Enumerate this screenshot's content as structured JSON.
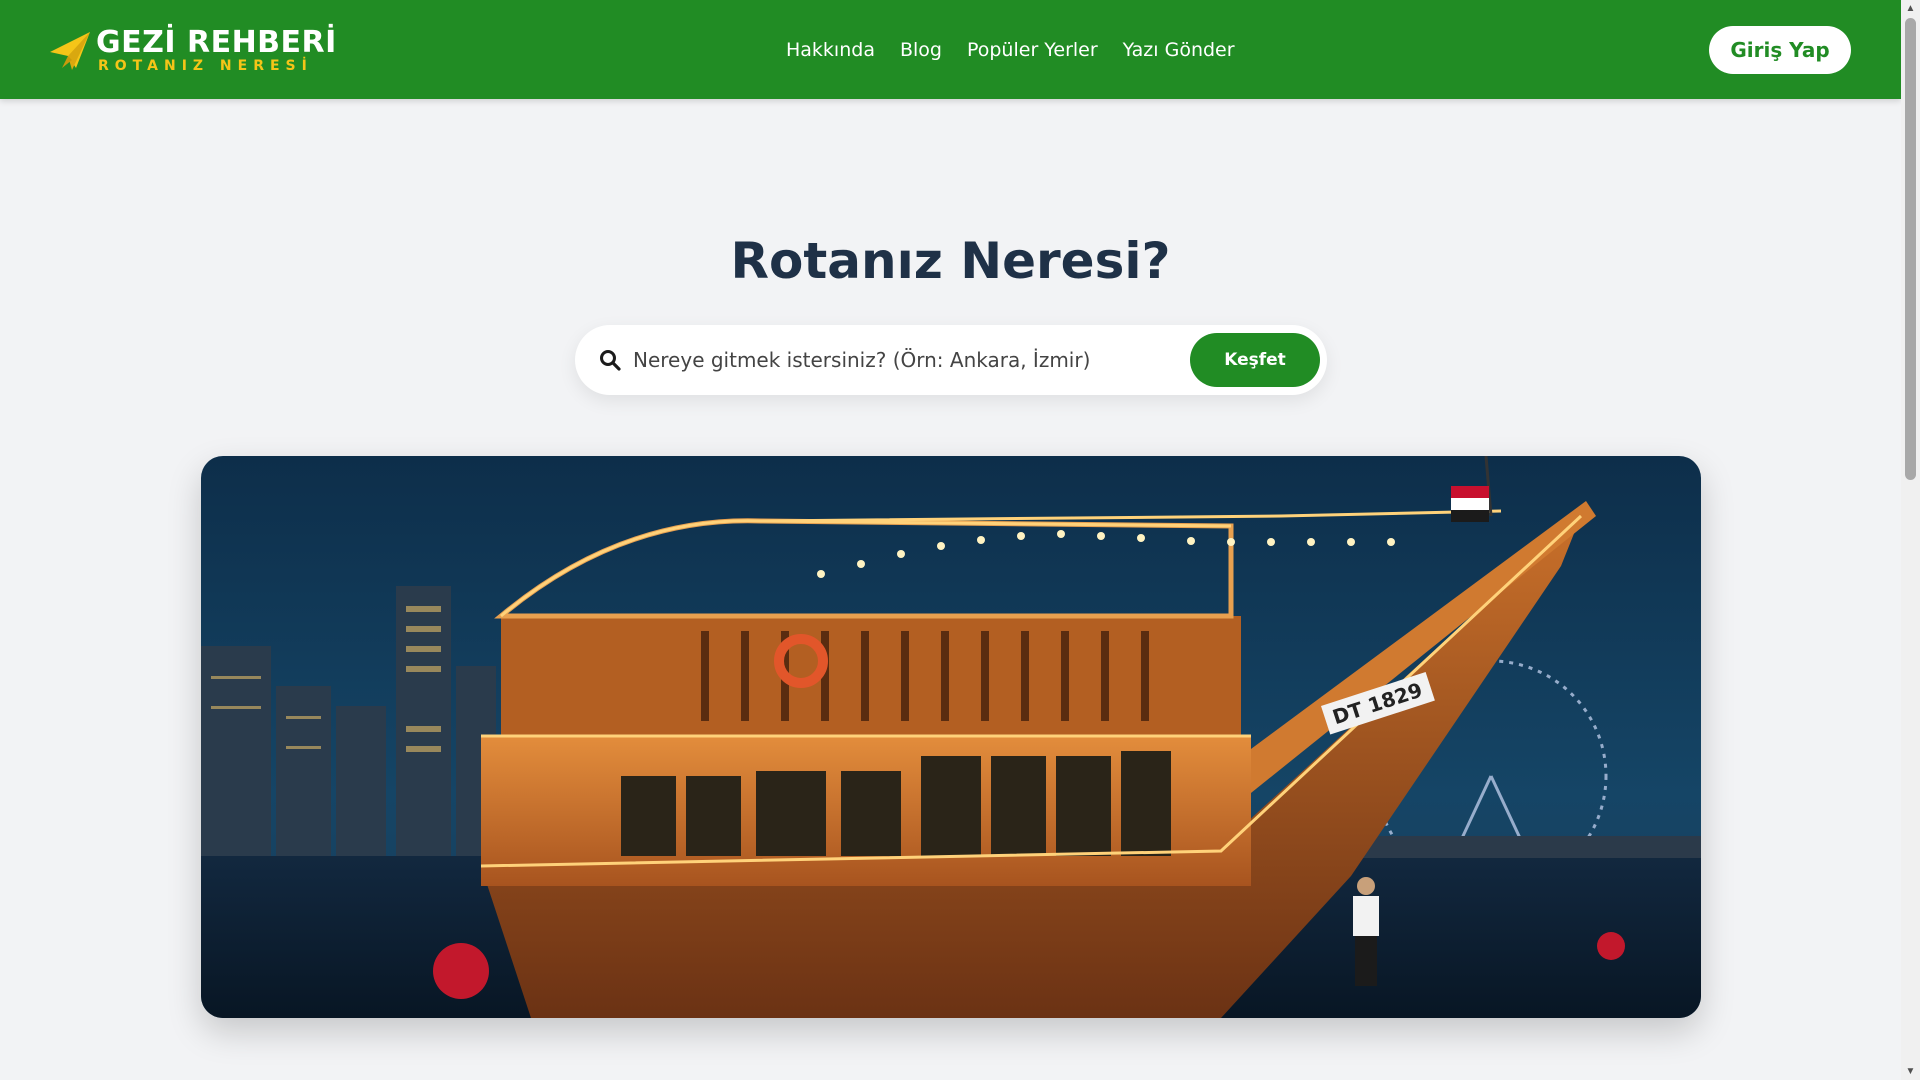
{
  "brand": {
    "title": "GEZİ REHBERİ",
    "subtitle": "ROTANIZ NERESİ",
    "colors": {
      "primary": "#218c24",
      "accent": "#f5c518",
      "heading": "#1f3147",
      "background": "#f2f3f5"
    }
  },
  "nav": {
    "items": [
      {
        "label": "Hakkında"
      },
      {
        "label": "Blog"
      },
      {
        "label": "Popüler Yerler"
      },
      {
        "label": "Yazı Gönder"
      }
    ],
    "login_label": "Giriş Yap"
  },
  "hero": {
    "title": "Rotanız Neresi?",
    "search": {
      "placeholder": "Nereye gitmek istersiniz? (Örn: Ankara, İzmir)",
      "value": "",
      "button_label": "Keşfet",
      "icon": "search-icon"
    },
    "image": {
      "boat_registration": "DT 1829"
    }
  },
  "icons": {
    "logo": "paper-plane-icon",
    "search": "search-icon",
    "scroll_up": "scroll-up-arrow-icon",
    "scroll_down": "scroll-down-arrow-icon"
  }
}
